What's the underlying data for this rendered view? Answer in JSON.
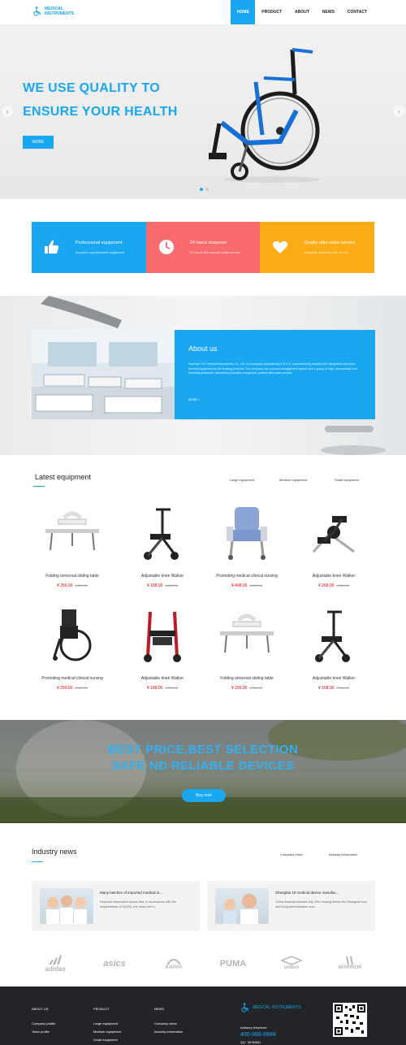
{
  "header": {
    "logo_text": "MEDICAL INSTRUMENTS",
    "nav": [
      {
        "label": "HOME",
        "active": true
      },
      {
        "label": "PRODUCT"
      },
      {
        "label": "ABOUT"
      },
      {
        "label": "NEWS"
      },
      {
        "label": "CONTACT"
      }
    ]
  },
  "hero": {
    "title_line1": "WE USE QUALITY TO",
    "title_line2": "ENSURE YOUR HEALTH",
    "more_label": "MORE",
    "prev_arrow": "‹",
    "next_arrow": "›"
  },
  "features": [
    {
      "title": "Professional equipment",
      "subtitle": "Imported sophisticated equipment",
      "color": "#18a7f0",
      "icon": "thumbs-up-icon"
    },
    {
      "title": "24 hours response",
      "subtitle": "24 Hours full manual online service",
      "color": "#fa6b6e",
      "icon": "clock-icon"
    },
    {
      "title": "Quality after-sales service",
      "subtitle": "problems solved by one to one",
      "color": "#fbac16",
      "icon": "heart-icon"
    }
  ],
  "about": {
    "title": "About us",
    "text": "Suzhuan XXX medical instruments Co., Ltd. is a company specializing in R & D, manufacturing hospital bed equipment and other medical equipment as the leading products. The company has a sound management system and a group of high, intermediate and technical personnel, advanced production equipment, perfect after-sales service.",
    "more": "MORE +"
  },
  "equipment": {
    "title": "Latest equipment",
    "tabs": [
      "Large equipment",
      "Medium equipment",
      "Small equipment"
    ],
    "products": [
      {
        "name": "Folding universal sliding table",
        "price": "¥ 256.00",
        "old_price": "¥ 320.00",
        "kind": "table"
      },
      {
        "name": "Adjustable knee Walker",
        "price": "¥ 168.00",
        "old_price": "¥ 320.00",
        "kind": "walker"
      },
      {
        "name": "Promoting medical clinical nursing",
        "price": "¥ 498.00",
        "old_price": "¥ 320.00",
        "kind": "chair"
      },
      {
        "name": "Adjustable knee Walker",
        "price": "¥ 268.00",
        "old_price": "¥ 320.00",
        "kind": "pedal"
      },
      {
        "name": "Promoting medical clinical nursing",
        "price": "¥ 299.00",
        "old_price": "¥ 320.00",
        "kind": "wheelchair"
      },
      {
        "name": "Adjustable knee Walker",
        "price": "¥ 188.00",
        "old_price": "¥ 320.00",
        "kind": "rollator"
      },
      {
        "name": "Folding universal sliding table",
        "price": "¥ 256.00",
        "old_price": "¥ 320.00",
        "kind": "table"
      },
      {
        "name": "Adjustable knee Walker",
        "price": "¥ 168.00",
        "old_price": "¥ 320.00",
        "kind": "walker"
      }
    ]
  },
  "banner": {
    "line1": "BEST PRICE,BEST SELECTION",
    "line2": "SAFE ND RELIABLE DEVICES",
    "button": "Buy now"
  },
  "news": {
    "title": "Industry news",
    "tabs": [
      "Company news",
      "Industry information"
    ],
    "items": [
      {
        "title": "Many batches of imported medical in...",
        "text": "Relevant information shows that, in accordance with the requirements of AQSIQ, the entry-exit in..."
      },
      {
        "title": "Shanghai 10 medical device manufac...",
        "text": "China financial network July 10th hearing before the Shanghai food and Drug Administration issu..."
      }
    ]
  },
  "brands": [
    "adidas",
    "asics",
    "KAPPA",
    "PUMA",
    "umbro",
    "WARRIOR"
  ],
  "footer": {
    "columns": [
      {
        "title": "ABOUT US",
        "items": [
          "Company profile",
          "Team profile"
        ]
      },
      {
        "title": "PRODUCT",
        "items": [
          "Large equipment",
          "Medium equipment",
          "Small equipment"
        ]
      },
      {
        "title": "NEWS",
        "items": [
          "Company news",
          "Industry information"
        ]
      }
    ],
    "logo_text": "MEDICAL INSTRUMENTS",
    "phone_label": "Advisory telephone:",
    "phone": "400-888-8888",
    "qq": "QQ：96784561"
  }
}
